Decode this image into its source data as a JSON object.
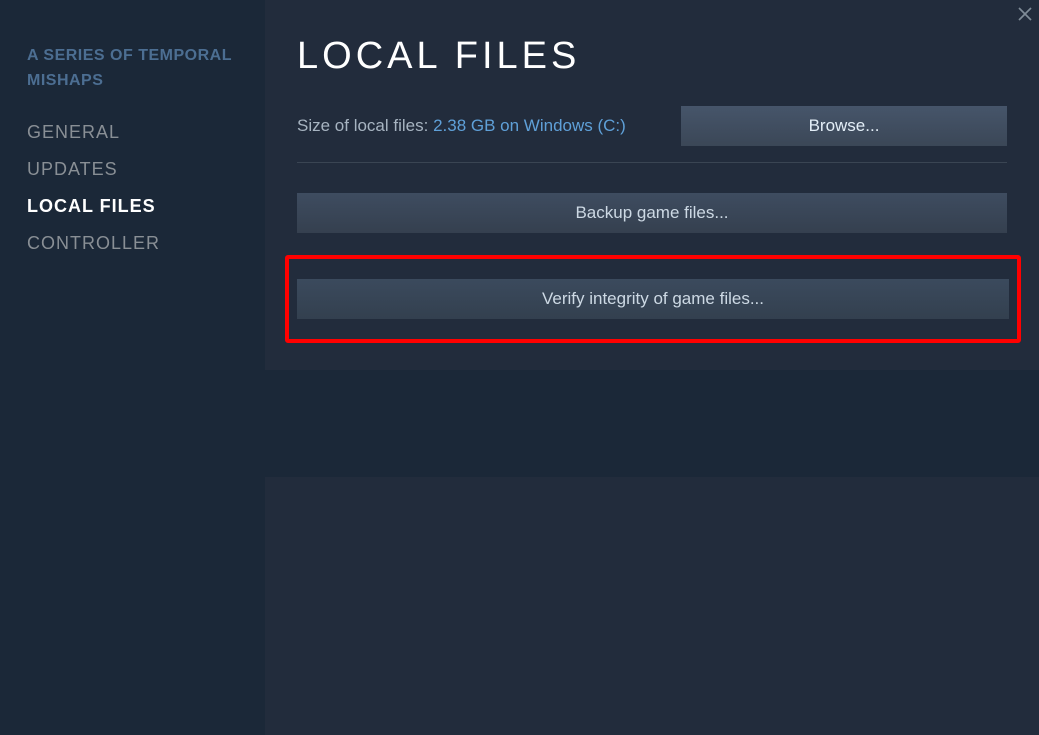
{
  "sidebar": {
    "game_title": "A SERIES OF TEMPORAL MISHAPS",
    "items": [
      {
        "label": "GENERAL",
        "active": false
      },
      {
        "label": "UPDATES",
        "active": false
      },
      {
        "label": "LOCAL FILES",
        "active": true
      },
      {
        "label": "CONTROLLER",
        "active": false
      }
    ]
  },
  "main": {
    "heading": "LOCAL FILES",
    "size_label": "Size of local files: ",
    "size_value": "2.38 GB on Windows (C:)",
    "browse_label": "Browse...",
    "backup_label": "Backup game files...",
    "verify_label": "Verify integrity of game files..."
  }
}
